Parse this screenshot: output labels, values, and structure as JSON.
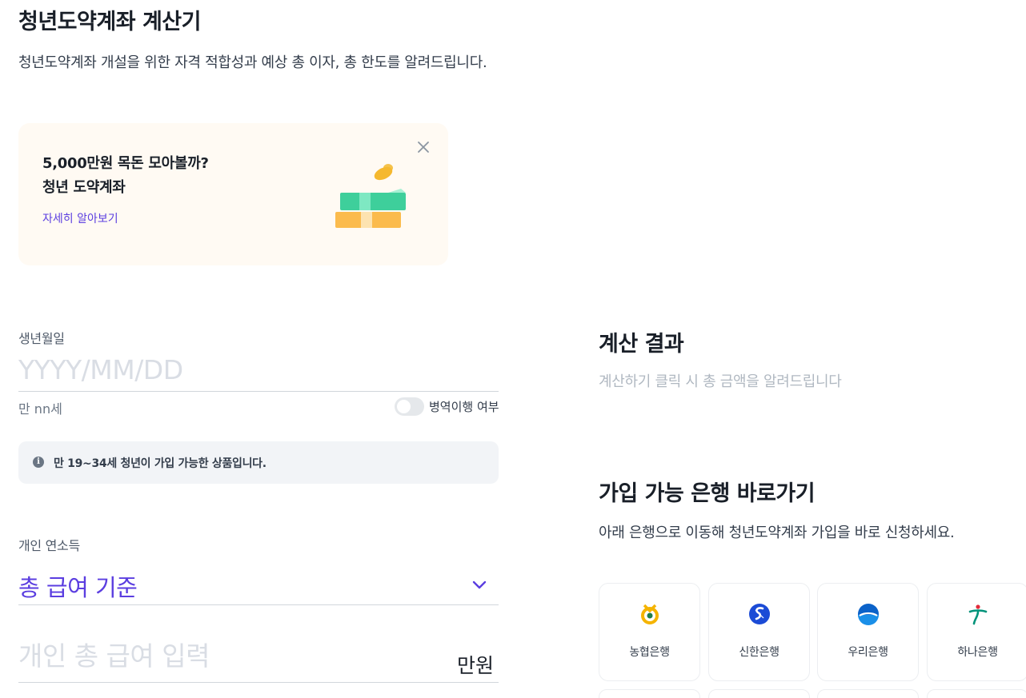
{
  "header": {
    "title": "청년도약계좌 계산기",
    "subtitle": "청년도약계좌 개설을 위한 자격 적합성과 예상 총 이자, 총 한도를 알려드립니다."
  },
  "promo": {
    "line1": "5,000만원 목돈 모아볼까?",
    "line2": "청년 도약계좌",
    "link_label": "자세히 알아보기"
  },
  "birth": {
    "label": "생년월일",
    "placeholder": "YYYY/MM/DD",
    "age_text": "만 nn세",
    "military_toggle_label": "병역이행 여부",
    "military_toggle_on": false
  },
  "info_notice": {
    "icon": "info-icon",
    "text": "만 19~34세 청년이 가입 가능한 상품입니다."
  },
  "income": {
    "label": "개인 연소득",
    "select_value": "총 급여 기준",
    "input_placeholder": "개인 총 급여 입력",
    "unit": "만원"
  },
  "result": {
    "title": "계산 결과",
    "description": "계산하기 클릭 시 총 금액을 알려드립니다"
  },
  "banks": {
    "title": "가입 가능 은행 바로가기",
    "description": "아래 은행으로 이동해 청년도약계좌 가입을 바로 신청하세요.",
    "items": [
      {
        "name": "농협은행",
        "icon": "nh-bank-logo-icon"
      },
      {
        "name": "신한은행",
        "icon": "shinhan-bank-logo-icon"
      },
      {
        "name": "우리은행",
        "icon": "woori-bank-logo-icon"
      },
      {
        "name": "하나은행",
        "icon": "hana-bank-logo-icon"
      }
    ]
  },
  "colors": {
    "accent": "#5b3ee0",
    "text_primary": "#191f28",
    "promo_bg": "#fffaf3",
    "info_bg": "#f2f4f7"
  }
}
